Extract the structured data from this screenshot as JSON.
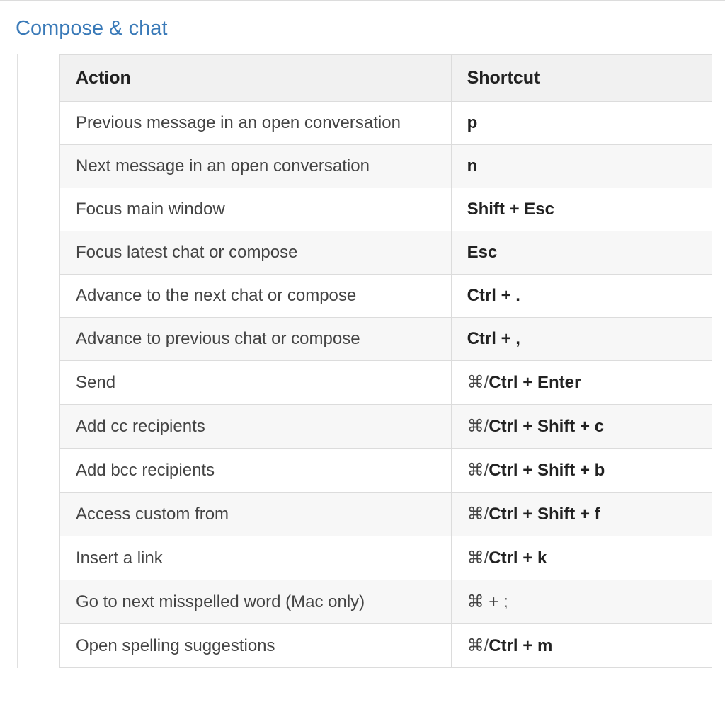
{
  "section_title": "Compose & chat",
  "table": {
    "headers": {
      "action": "Action",
      "shortcut": "Shortcut"
    },
    "rows": [
      {
        "action": "Previous message in an open conversation",
        "shortcut_html": "<span class='bold'>p</span>"
      },
      {
        "action": "Next message in an open conversation",
        "shortcut_html": "<span class='bold'>n</span>"
      },
      {
        "action": "Focus main window",
        "shortcut_html": "<span class='bold'>Shift + Esc</span>"
      },
      {
        "action": "Focus latest chat or compose",
        "shortcut_html": "<span class='bold'>Esc</span>"
      },
      {
        "action": "Advance to the next chat or compose",
        "shortcut_html": "<span class='bold'>Ctrl + .</span>"
      },
      {
        "action": "Advance to previous chat or compose",
        "shortcut_html": "<span class='bold'>Ctrl + ,</span>"
      },
      {
        "action": "Send",
        "shortcut_html": "<span class='normal'>⌘/</span><span class='bold'>Ctrl + Enter</span>"
      },
      {
        "action": "Add cc recipients",
        "shortcut_html": "<span class='normal'>⌘/</span><span class='bold'>Ctrl + Shift + c</span>"
      },
      {
        "action": "Add bcc recipients",
        "shortcut_html": "<span class='normal'>⌘/</span><span class='bold'>Ctrl + Shift + b</span>"
      },
      {
        "action": "Access custom from",
        "shortcut_html": "<span class='normal'>⌘/</span><span class='bold'>Ctrl + Shift + f</span>"
      },
      {
        "action": "Insert a link",
        "shortcut_html": "<span class='normal'>⌘/</span><span class='bold'>Ctrl + k</span>"
      },
      {
        "action": "Go to next misspelled word (Mac only)",
        "shortcut_html": "<span class='normal'>⌘ + ;</span>"
      },
      {
        "action": "Open spelling suggestions",
        "shortcut_html": "<span class='normal'>⌘/</span><span class='bold'>Ctrl + m</span>"
      }
    ]
  }
}
